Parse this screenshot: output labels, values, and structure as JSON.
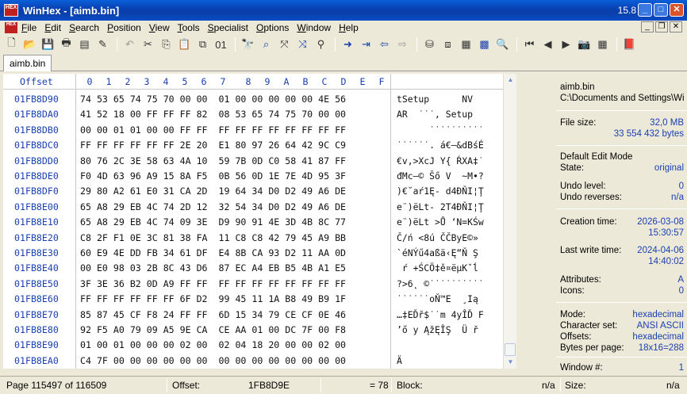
{
  "window": {
    "title": "WinHex - [aimb.bin]",
    "version": "15.8",
    "icon_label": "HEX"
  },
  "menu": [
    "File",
    "Edit",
    "Search",
    "Position",
    "View",
    "Tools",
    "Specialist",
    "Options",
    "Window",
    "Help"
  ],
  "tab": {
    "label": "aimb.bin"
  },
  "hex_header": {
    "offset_label": "Offset",
    "columns": [
      "0",
      "1",
      "2",
      "3",
      "4",
      "5",
      "6",
      "7",
      "8",
      "9",
      "A",
      "B",
      "C",
      "D",
      "E",
      "F"
    ]
  },
  "rows": [
    {
      "offset": "01FB8D90",
      "hex": "74 53 65 74 75 70 00 00  01 00 00 00 00 00 4E 56",
      "text": "tSetup      NV"
    },
    {
      "offset": "01FB8DA0",
      "hex": "41 52 18 00 FF FF FF 82  08 53 65 74 75 70 00 00",
      "text": "AR  ˙˙˙‚ Setup  "
    },
    {
      "offset": "01FB8DB0",
      "hex": "00 00 01 01 00 00 FF FF  FF FF FF FF FF FF FF FF",
      "text": "      ˙˙˙˙˙˙˙˙˙˙"
    },
    {
      "offset": "01FB8DC0",
      "hex": "FF FF FF FF FF FF 2E 20  E1 80 97 26 64 42 9C C9",
      "text": "˙˙˙˙˙˙. á€—&dBśÉ"
    },
    {
      "offset": "01FB8DD0",
      "hex": "80 76 2C 3E 58 63 4A 10  59 7B 0D C0 58 41 87 FF",
      "text": "€v,>XcJ Y{ ŔXA‡˙"
    },
    {
      "offset": "01FB8DE0",
      "hex": "F0 4D 63 96 A9 15 8A F5  0B 56 0D 1E 7E 4D 95 3F",
      "text": "đMc–© Šő V  ~M•?"
    },
    {
      "offset": "01FB8DF0",
      "hex": "29 80 A2 61 E0 31 CA 2D  19 64 34 D0 D2 49 A6 DE",
      "text": ")€˘aŕ1Ę- d4ĐŇI¦Ţ"
    },
    {
      "offset": "01FB8E00",
      "hex": "65 A8 29 EB 4C 74 2D 12  32 54 34 D0 D2 49 A6 DE",
      "text": "e¨)ëLt- 2T4ĐŇI¦Ţ"
    },
    {
      "offset": "01FB8E10",
      "hex": "65 A8 29 EB 4C 74 09 3E  D9 90 91 4E 3D 4B 8C 77",
      "text": "e¨)ëLt >Ů ‘N=KŚw"
    },
    {
      "offset": "01FB8E20",
      "hex": "C8 2F F1 0E 3C 81 38 FA  11 C8 C8 42 79 45 A9 BB",
      "text": "Č/ń <8ú ČČByE©»"
    },
    {
      "offset": "01FB8E30",
      "hex": "60 E9 4E DD FB 34 61 DF  E4 8B CA 93 D2 11 AA 0D",
      "text": "`éNÝű4aßä‹Ę“Ň Ş "
    },
    {
      "offset": "01FB8E40",
      "hex": "00 E0 98 03 2B 8C 43 D6  87 EC A4 EB B5 4B A1 E5",
      "text": " ŕ +ŚCÖ‡ě¤ëµKˇĺ"
    },
    {
      "offset": "01FB8E50",
      "hex": "3F 3E 36 B2 0D A9 FF FF  FF FF FF FF FF FF FF FF",
      "text": "?>6˛ ©˙˙˙˙˙˙˙˙˙˙"
    },
    {
      "offset": "01FB8E60",
      "hex": "FF FF FF FF FF FF 6F D2  99 45 11 1A B8 49 B9 1F",
      "text": "˙˙˙˙˙˙oŇ™E  ¸Ią "
    },
    {
      "offset": "01FB8E70",
      "hex": "85 87 45 CF F8 24 FF FF  6D 15 34 79 CE CF 0E 46",
      "text": "…‡EĎř$˙˙m 4yÎĎ F"
    },
    {
      "offset": "01FB8E80",
      "hex": "92 F5 A0 79 09 A5 9E CA  CE AA 01 00 DC 7F 00 F8",
      "text": "’ő y ĄžĘÎŞ  Ü ř"
    },
    {
      "offset": "01FB8E90",
      "hex": "01 00 01 00 00 00 02 00  02 04 18 20 00 00 02 00",
      "text": "                "
    },
    {
      "offset": "01FB8EA0",
      "hex": "C4 7F 00 00 00 00 00 00  00 00 00 00 00 00 00 00",
      "text": "Ä               "
    }
  ],
  "info": {
    "file_name": "aimb.bin",
    "file_path": "C:\\Documents and Settings\\Wi",
    "file_size_label": "File size:",
    "file_size_mb": "32,0 MB",
    "file_size_bytes": "33 554 432 bytes",
    "edit_mode_label": "Default Edit Mode",
    "state_label": "State:",
    "state_value": "original",
    "undo_level_label": "Undo level:",
    "undo_level_value": "0",
    "undo_reverses_label": "Undo reverses:",
    "undo_reverses_value": "n/a",
    "creation_label": "Creation time:",
    "creation_date": "2026-03-08",
    "creation_time": "15:30:57",
    "write_label": "Last write time:",
    "write_date": "2024-04-06",
    "write_time": "14:40:02",
    "attributes_label": "Attributes:",
    "attributes_value": "A",
    "icons_label": "Icons:",
    "icons_value": "0",
    "mode_label": "Mode:",
    "mode_value": "hexadecimal",
    "charset_label": "Character set:",
    "charset_value": "ANSI ASCII",
    "offsets_label": "Offsets:",
    "offsets_value": "hexadecimal",
    "bpp_label": "Bytes per page:",
    "bpp_value": "18x16=288",
    "window_label": "Window #:",
    "window_value": "1"
  },
  "status": {
    "page": "Page 115497 of 116509",
    "offset_label": "Offset:",
    "offset_value": "1FB8D9E",
    "eq_value": "= 78",
    "block_label": "Block:",
    "block_value": "n/a",
    "size_label": "Size:",
    "size_value": "n/a"
  },
  "colors": {
    "offset_blue": "#1a3fb0",
    "titlebar": "#0842b5"
  }
}
